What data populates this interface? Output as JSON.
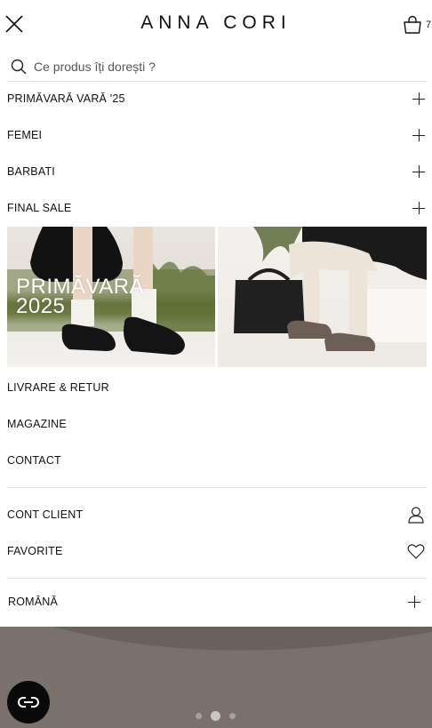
{
  "header": {
    "logo": "ANNA CORI",
    "cart_count": "7"
  },
  "search": {
    "placeholder": "Ce produs îți dorești ?"
  },
  "menu": {
    "categories": [
      {
        "label": "PRIMĂVARĂ VARĂ '25"
      },
      {
        "label": "FEMEI"
      },
      {
        "label": "BARBATI"
      },
      {
        "label": "FINAL SALE"
      }
    ],
    "banner": {
      "title_line1": "PRIMĂVARĂ",
      "title_line2": "2025"
    },
    "links": [
      {
        "label": "LIVRARE & RETUR"
      },
      {
        "label": "MAGAZINE"
      },
      {
        "label": "CONTACT"
      }
    ],
    "account": {
      "label": "CONT CLIENT",
      "icon": "user-icon"
    },
    "favorites": {
      "label": "FAVORITE",
      "icon": "heart-icon"
    },
    "language": {
      "label": "ROMÂNĂ"
    }
  },
  "carousel": {
    "slides": 3,
    "active": 2
  },
  "colors": {
    "text": "#111111",
    "divider": "#e6e6e6",
    "chat_button": "#0a0a0a"
  }
}
